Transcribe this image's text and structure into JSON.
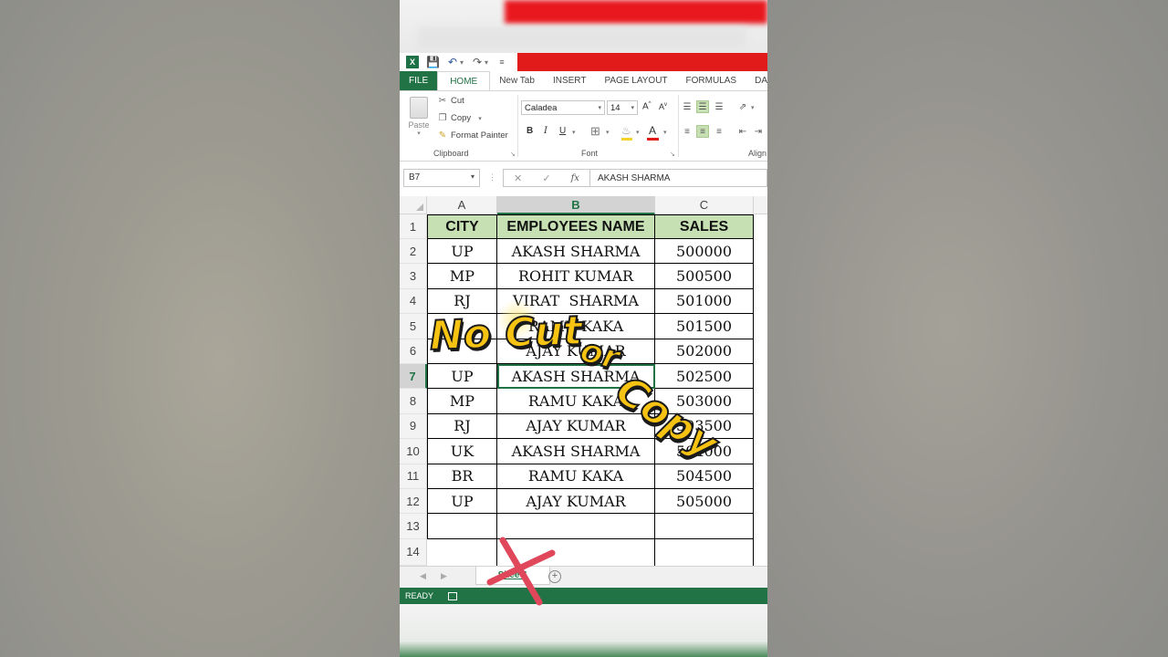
{
  "window": {
    "app_icon": "excel-icon",
    "quick_access": [
      "save-icon",
      "undo-icon",
      "redo-icon",
      "customize-icon"
    ]
  },
  "ribbon": {
    "tabs": [
      "FILE",
      "HOME",
      "New Tab",
      "INSERT",
      "PAGE LAYOUT",
      "FORMULAS",
      "DA"
    ],
    "active_tab": "HOME",
    "clipboard": {
      "paste_label": "Paste",
      "cut_label": "Cut",
      "copy_label": "Copy",
      "format_painter_label": "Format Painter",
      "group_label": "Clipboard"
    },
    "font": {
      "font_name": "Caladea",
      "font_size": "14",
      "bold": "B",
      "italic": "I",
      "underline": "U",
      "group_label": "Font"
    },
    "alignment": {
      "group_label": "Align"
    }
  },
  "formula_bar": {
    "name_box": "B7",
    "cancel": "✕",
    "enter": "✓",
    "fx": "fx",
    "value": "AKASH SHARMA"
  },
  "grid": {
    "columns": [
      "A",
      "B",
      "C"
    ],
    "selected_column": "B",
    "selected_row": "7",
    "header_row": {
      "row": "1",
      "cells": [
        "CITY",
        "EMPLOYEES NAME",
        "SALES"
      ]
    },
    "rows": [
      {
        "row": "2",
        "cells": [
          "UP",
          "AKASH SHARMA",
          "500000"
        ]
      },
      {
        "row": "3",
        "cells": [
          "MP",
          "ROHIT KUMAR",
          "500500"
        ]
      },
      {
        "row": "4",
        "cells": [
          "RJ",
          "VIRAT  SHARMA",
          "501000"
        ]
      },
      {
        "row": "5",
        "cells": [
          "",
          "RAMU KAKA",
          "501500"
        ]
      },
      {
        "row": "6",
        "cells": [
          "",
          "AJAY KUMAR",
          "502000"
        ]
      },
      {
        "row": "7",
        "cells": [
          "UP",
          "AKASH SHARMA",
          "502500"
        ]
      },
      {
        "row": "8",
        "cells": [
          "MP",
          "RAMU KAKA",
          "503000"
        ]
      },
      {
        "row": "9",
        "cells": [
          "RJ",
          "AJAY KUMAR",
          "503500"
        ]
      },
      {
        "row": "10",
        "cells": [
          "UK",
          "AKASH SHARMA",
          "504000"
        ]
      },
      {
        "row": "11",
        "cells": [
          "BR",
          "RAMU KAKA",
          "504500"
        ]
      },
      {
        "row": "12",
        "cells": [
          "UP",
          "AJAY KUMAR",
          "505000"
        ]
      },
      {
        "row": "13",
        "cells": [
          "",
          "",
          ""
        ]
      },
      {
        "row": "14",
        "cells": [
          "",
          "",
          ""
        ]
      }
    ]
  },
  "sheets": {
    "tabs": [
      "Sheet1"
    ],
    "active": "Sheet1",
    "add": "+"
  },
  "status_bar": {
    "text": "READY"
  },
  "overlay": {
    "line1": "No Cut",
    "line2": "or",
    "line3": "Copy",
    "text_color": "#f6c312",
    "cross_color": "#e0475a"
  },
  "colors": {
    "excel_green": "#217346",
    "header_fill": "#c6e0b4",
    "red_band": "#e11a1a"
  }
}
